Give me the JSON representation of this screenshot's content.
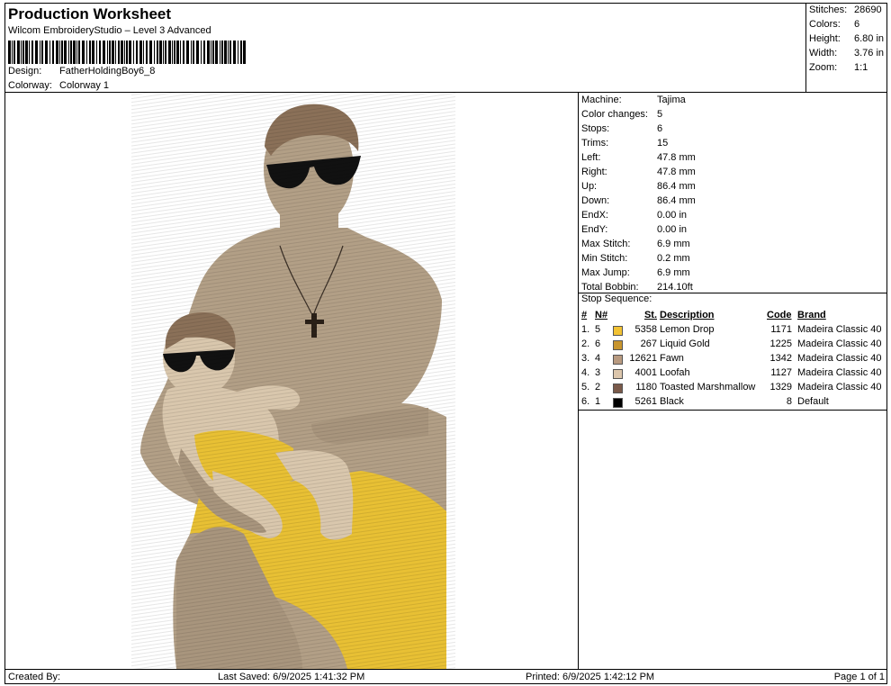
{
  "header": {
    "title": "Production Worksheet",
    "software": "Wilcom EmbroideryStudio – Level 3 Advanced",
    "design_label": "Design:",
    "design_value": "FatherHoldingBoy6_8",
    "colorway_label": "Colorway:",
    "colorway_value": "Colorway 1"
  },
  "stats": [
    {
      "label": "Stitches:",
      "value": "28690"
    },
    {
      "label": "Colors:",
      "value": "6"
    },
    {
      "label": "Height:",
      "value": "6.80 in"
    },
    {
      "label": "Width:",
      "value": "3.76 in"
    },
    {
      "label": "Zoom:",
      "value": "1:1"
    }
  ],
  "machine_info": [
    {
      "label": "Machine:",
      "value": "Tajima"
    },
    {
      "label": "Color changes:",
      "value": "5"
    },
    {
      "label": "Stops:",
      "value": "6"
    },
    {
      "label": "Trims:",
      "value": "15"
    },
    {
      "label": "Left:",
      "value": "47.8 mm"
    },
    {
      "label": "Right:",
      "value": "47.8 mm"
    },
    {
      "label": "Up:",
      "value": "86.4 mm"
    },
    {
      "label": "Down:",
      "value": "86.4 mm"
    },
    {
      "label": "EndX:",
      "value": "0.00 in"
    },
    {
      "label": "EndY:",
      "value": "0.00 in"
    },
    {
      "label": "Max Stitch:",
      "value": "6.9 mm"
    },
    {
      "label": "Min Stitch:",
      "value": "0.2 mm"
    },
    {
      "label": "Max Jump:",
      "value": "6.9 mm"
    },
    {
      "label": "Total Bobbin:",
      "value": "214.10ft"
    }
  ],
  "stop_sequence": {
    "title": "Stop Sequence:",
    "headers": {
      "num": "#",
      "n": "N#",
      "st": "St.",
      "description": "Description",
      "code": "Code",
      "brand": "Brand"
    },
    "rows": [
      {
        "num": "1.",
        "n": "5",
        "color": "#f2c233",
        "st": "5358",
        "description": "Lemon Drop",
        "code": "1171",
        "brand": "Madeira Classic 40"
      },
      {
        "num": "2.",
        "n": "6",
        "color": "#c8952e",
        "st": "267",
        "description": "Liquid Gold",
        "code": "1225",
        "brand": "Madeira Classic 40"
      },
      {
        "num": "3.",
        "n": "4",
        "color": "#b89a80",
        "st": "12621",
        "description": "Fawn",
        "code": "1342",
        "brand": "Madeira Classic 40"
      },
      {
        "num": "4.",
        "n": "3",
        "color": "#dcc6ac",
        "st": "4001",
        "description": "Loofah",
        "code": "1127",
        "brand": "Madeira Classic 40"
      },
      {
        "num": "5.",
        "n": "2",
        "color": "#7a5a4a",
        "st": "1180",
        "description": "Toasted Marshmallow",
        "code": "1329",
        "brand": "Madeira Classic 40"
      },
      {
        "num": "6.",
        "n": "1",
        "color": "#000000",
        "st": "5261",
        "description": "Black",
        "code": "8",
        "brand": "Default"
      }
    ]
  },
  "footer": {
    "created_by": "Created By:",
    "last_saved": "Last Saved: 6/9/2025 1:41:32 PM",
    "printed": "Printed: 6/9/2025 1:42:12 PM",
    "page": "Page 1 of 1"
  },
  "colors": {
    "skin": "#b29f86",
    "skin_dark": "#8f7c66",
    "hair": "#8a7058",
    "shorts": "#e8c034",
    "baby_skin": "#d9c7ad",
    "lenses": "#111111"
  }
}
